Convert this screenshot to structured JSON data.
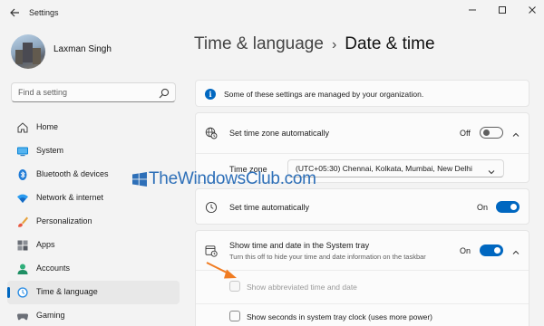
{
  "window": {
    "title": "Settings"
  },
  "user": {
    "name": "Laxman Singh"
  },
  "search": {
    "placeholder": "Find a setting"
  },
  "sidebar": {
    "items": [
      {
        "label": "Home",
        "icon": "home-icon"
      },
      {
        "label": "System",
        "icon": "system-icon"
      },
      {
        "label": "Bluetooth & devices",
        "icon": "bluetooth-icon"
      },
      {
        "label": "Network & internet",
        "icon": "network-icon"
      },
      {
        "label": "Personalization",
        "icon": "personalization-icon"
      },
      {
        "label": "Apps",
        "icon": "apps-icon"
      },
      {
        "label": "Accounts",
        "icon": "accounts-icon"
      },
      {
        "label": "Time & language",
        "icon": "time-language-icon",
        "selected": true
      },
      {
        "label": "Gaming",
        "icon": "gaming-icon"
      }
    ]
  },
  "breadcrumb": {
    "parent": "Time & language",
    "separator": "›",
    "current": "Date & time"
  },
  "banner": {
    "text": "Some of these settings are managed by your organization."
  },
  "timezone_auto": {
    "label": "Set time zone automatically",
    "state": "Off",
    "on": false
  },
  "timezone": {
    "label": "Time zone",
    "value": "(UTC+05:30) Chennai, Kolkata, Mumbai, New Delhi"
  },
  "time_auto": {
    "label": "Set time automatically",
    "state": "On",
    "on": true
  },
  "tray": {
    "label": "Show time and date in the System tray",
    "description": "Turn this off to hide your time and date information on the taskbar",
    "state": "On",
    "on": true,
    "abbrev_label": "Show abbreviated time and date",
    "seconds_label": "Show seconds in system tray clock (uses more power)"
  },
  "watermark": {
    "text": "TheWindowsClub.com"
  },
  "colors": {
    "accent": "#0067c0",
    "background": "#f3f3f3",
    "card": "#fbfbfb",
    "arrow": "#f07c22"
  }
}
